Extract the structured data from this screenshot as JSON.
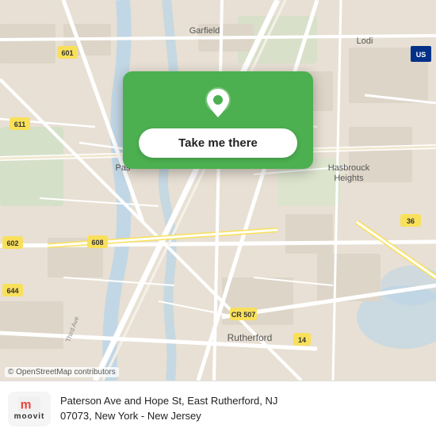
{
  "map": {
    "attribution": "© OpenStreetMap contributors",
    "region": "New Jersey - New York area"
  },
  "location_card": {
    "button_label": "Take me there",
    "pin_color": "#ffffff"
  },
  "info_bar": {
    "address_line1": "Paterson Ave and Hope St, East Rutherford, NJ",
    "address_line2": "07073, New York - New Jersey",
    "logo_text": "moovit"
  },
  "colors": {
    "card_green": "#4CAF50",
    "road_major": "#ffffff",
    "road_minor": "#f5f0e8",
    "road_highlight": "#f9e05a",
    "map_bg": "#e8e0d4",
    "water": "#b8d4e8",
    "park": "#c8dfc0"
  }
}
